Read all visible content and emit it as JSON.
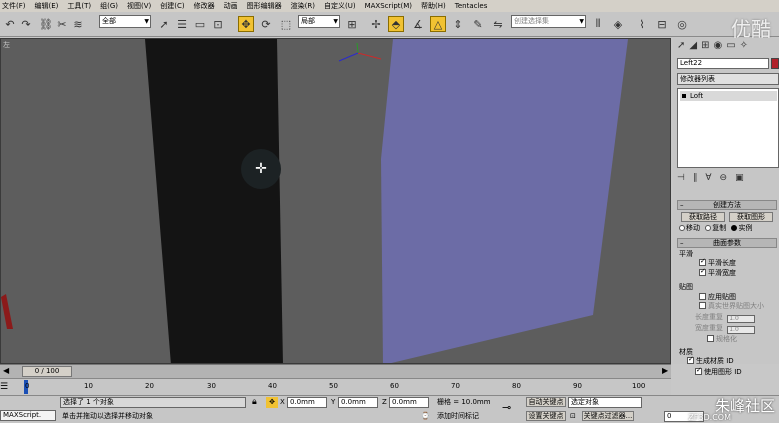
{
  "menu": [
    "文件(F)",
    "编辑(E)",
    "工具(T)",
    "组(G)",
    "视图(V)",
    "创建(C)",
    "修改器",
    "动画",
    "图形编辑器",
    "渲染(R)",
    "自定义(U)",
    "MAXScript(M)",
    "帮助(H)",
    "Tentacles"
  ],
  "toolbar": {
    "selection_filter": "全部",
    "ref_coord": "局部",
    "named_selection_placeholder": "创建选择集",
    "logo": "优酷"
  },
  "viewport": {
    "label": "左"
  },
  "command_panel": {
    "object_name": "Left22",
    "object_color": "#b0212a",
    "modifier_list": "修改器列表",
    "stack_item": "Loft",
    "rollout_creation": "创建方法",
    "get_path": "获取路径",
    "get_shape": "获取图形",
    "radio_move": "移动",
    "radio_copy": "复制",
    "radio_instance": "实例",
    "rollout_surface": "曲面参数",
    "smooth_group": "平滑",
    "smooth_length": "平滑长度",
    "smooth_width": "平滑宽度",
    "mapping_group": "贴图",
    "apply_mapping": "应用贴图",
    "real_world": "真实世界贴图大小",
    "length_repeat": "长度重复",
    "length_value": "1.0",
    "width_repeat": "宽度重复",
    "width_value": "1.0",
    "normalize": "规格化",
    "material_group": "材质",
    "gen_mat_ids": "生成材质 ID",
    "use_shape_ids": "使用图形 ID"
  },
  "time_slider": {
    "frame": "0 / 100"
  },
  "ruler_ticks": [
    "0",
    "10",
    "20",
    "30",
    "40",
    "50",
    "60",
    "70",
    "80",
    "90",
    "100"
  ],
  "status": {
    "maxscript": "MAXScript.",
    "selection_info": "选择了 1 个对象",
    "prompt": "单击并拖动以选择并移动对象",
    "x_value": "0.0mm",
    "y_value": "0.0mm",
    "z_value": "0.0mm",
    "grid": "栅格 = 10.0mm",
    "add_time_tag": "添加时间标记",
    "auto_key": "自动关键点",
    "set_key": "设置关键点",
    "key_filter_target": "选定对象",
    "key_filters": "关键点过滤器...",
    "frame_field": "0"
  },
  "watermark": {
    "title": "朱峰社区",
    "url": "ZF3D.COM"
  }
}
